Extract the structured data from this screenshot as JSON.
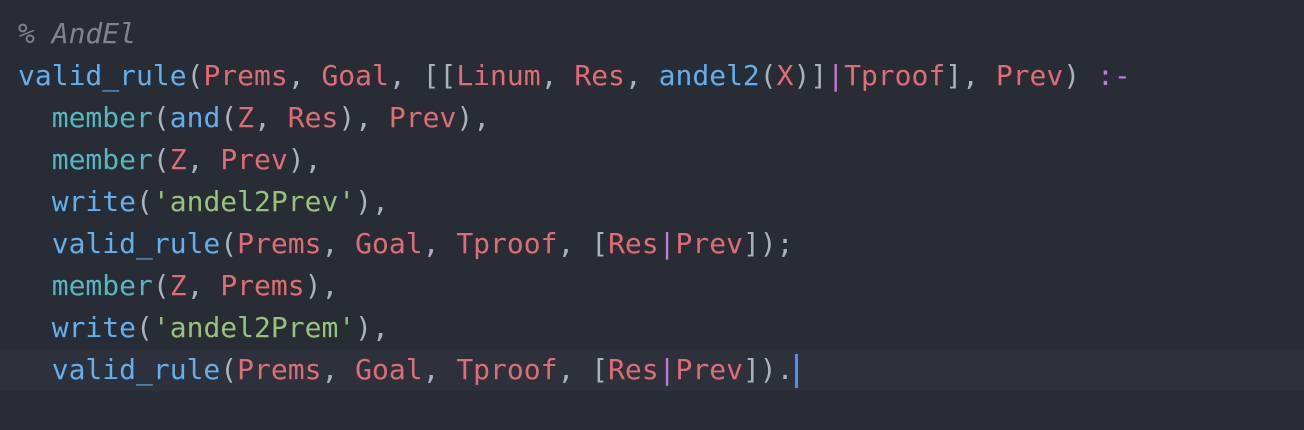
{
  "editor": {
    "colors": {
      "background": "#282c34",
      "active_line": "#2c313c",
      "comment": "#7f848e",
      "function": "#61afef",
      "builtin": "#56b6c2",
      "variable": "#e06c75",
      "string": "#98c379",
      "operator": "#c678dd",
      "punctuation": "#abb2bf",
      "cursor": "#528bff"
    },
    "lines": [
      {
        "tokens": [
          {
            "text": "% AndEl",
            "type": "comment"
          }
        ]
      },
      {
        "tokens": [
          {
            "text": "valid_rule",
            "type": "function"
          },
          {
            "text": "(",
            "type": "punctuation"
          },
          {
            "text": "Prems",
            "type": "variable"
          },
          {
            "text": ", ",
            "type": "punctuation"
          },
          {
            "text": "Goal",
            "type": "variable"
          },
          {
            "text": ", [[",
            "type": "punctuation"
          },
          {
            "text": "Linum",
            "type": "variable"
          },
          {
            "text": ", ",
            "type": "punctuation"
          },
          {
            "text": "Res",
            "type": "variable"
          },
          {
            "text": ", ",
            "type": "punctuation"
          },
          {
            "text": "andel2",
            "type": "function"
          },
          {
            "text": "(",
            "type": "punctuation"
          },
          {
            "text": "X",
            "type": "variable"
          },
          {
            "text": ")]",
            "type": "punctuation"
          },
          {
            "text": "|",
            "type": "operator"
          },
          {
            "text": "Tproof",
            "type": "variable"
          },
          {
            "text": "], ",
            "type": "punctuation"
          },
          {
            "text": "Prev",
            "type": "variable"
          },
          {
            "text": ") ",
            "type": "punctuation"
          },
          {
            "text": ":-",
            "type": "operator"
          }
        ]
      },
      {
        "tokens": [
          {
            "text": "  ",
            "type": "punctuation"
          },
          {
            "text": "member",
            "type": "builtin"
          },
          {
            "text": "(",
            "type": "punctuation"
          },
          {
            "text": "and",
            "type": "function"
          },
          {
            "text": "(",
            "type": "punctuation"
          },
          {
            "text": "Z",
            "type": "variable"
          },
          {
            "text": ", ",
            "type": "punctuation"
          },
          {
            "text": "Res",
            "type": "variable"
          },
          {
            "text": "), ",
            "type": "punctuation"
          },
          {
            "text": "Prev",
            "type": "variable"
          },
          {
            "text": "),",
            "type": "punctuation"
          }
        ]
      },
      {
        "tokens": [
          {
            "text": "  ",
            "type": "punctuation"
          },
          {
            "text": "member",
            "type": "builtin"
          },
          {
            "text": "(",
            "type": "punctuation"
          },
          {
            "text": "Z",
            "type": "variable"
          },
          {
            "text": ", ",
            "type": "punctuation"
          },
          {
            "text": "Prev",
            "type": "variable"
          },
          {
            "text": "),",
            "type": "punctuation"
          }
        ]
      },
      {
        "tokens": [
          {
            "text": "  ",
            "type": "punctuation"
          },
          {
            "text": "write",
            "type": "function"
          },
          {
            "text": "(",
            "type": "punctuation"
          },
          {
            "text": "'andel2Prev'",
            "type": "string"
          },
          {
            "text": "),",
            "type": "punctuation"
          }
        ]
      },
      {
        "tokens": [
          {
            "text": "  ",
            "type": "punctuation"
          },
          {
            "text": "valid_rule",
            "type": "function"
          },
          {
            "text": "(",
            "type": "punctuation"
          },
          {
            "text": "Prems",
            "type": "variable"
          },
          {
            "text": ", ",
            "type": "punctuation"
          },
          {
            "text": "Goal",
            "type": "variable"
          },
          {
            "text": ", ",
            "type": "punctuation"
          },
          {
            "text": "Tproof",
            "type": "variable"
          },
          {
            "text": ", [",
            "type": "punctuation"
          },
          {
            "text": "Res",
            "type": "variable"
          },
          {
            "text": "|",
            "type": "operator"
          },
          {
            "text": "Prev",
            "type": "variable"
          },
          {
            "text": "]);",
            "type": "punctuation"
          }
        ]
      },
      {
        "tokens": [
          {
            "text": "  ",
            "type": "punctuation"
          },
          {
            "text": "member",
            "type": "builtin"
          },
          {
            "text": "(",
            "type": "punctuation"
          },
          {
            "text": "Z",
            "type": "variable"
          },
          {
            "text": ", ",
            "type": "punctuation"
          },
          {
            "text": "Prems",
            "type": "variable"
          },
          {
            "text": "),",
            "type": "punctuation"
          }
        ]
      },
      {
        "tokens": [
          {
            "text": "  ",
            "type": "punctuation"
          },
          {
            "text": "write",
            "type": "function"
          },
          {
            "text": "(",
            "type": "punctuation"
          },
          {
            "text": "'andel2Prem'",
            "type": "string"
          },
          {
            "text": "),",
            "type": "punctuation"
          }
        ]
      },
      {
        "active": true,
        "cursor": true,
        "tokens": [
          {
            "text": "  ",
            "type": "punctuation"
          },
          {
            "text": "valid_rule",
            "type": "function"
          },
          {
            "text": "(",
            "type": "punctuation"
          },
          {
            "text": "Prems",
            "type": "variable"
          },
          {
            "text": ", ",
            "type": "punctuation"
          },
          {
            "text": "Goal",
            "type": "variable"
          },
          {
            "text": ", ",
            "type": "punctuation"
          },
          {
            "text": "Tproof",
            "type": "variable"
          },
          {
            "text": ", [",
            "type": "punctuation"
          },
          {
            "text": "Res",
            "type": "variable"
          },
          {
            "text": "|",
            "type": "operator"
          },
          {
            "text": "Prev",
            "type": "variable"
          },
          {
            "text": "]).",
            "type": "punctuation"
          }
        ]
      }
    ]
  }
}
